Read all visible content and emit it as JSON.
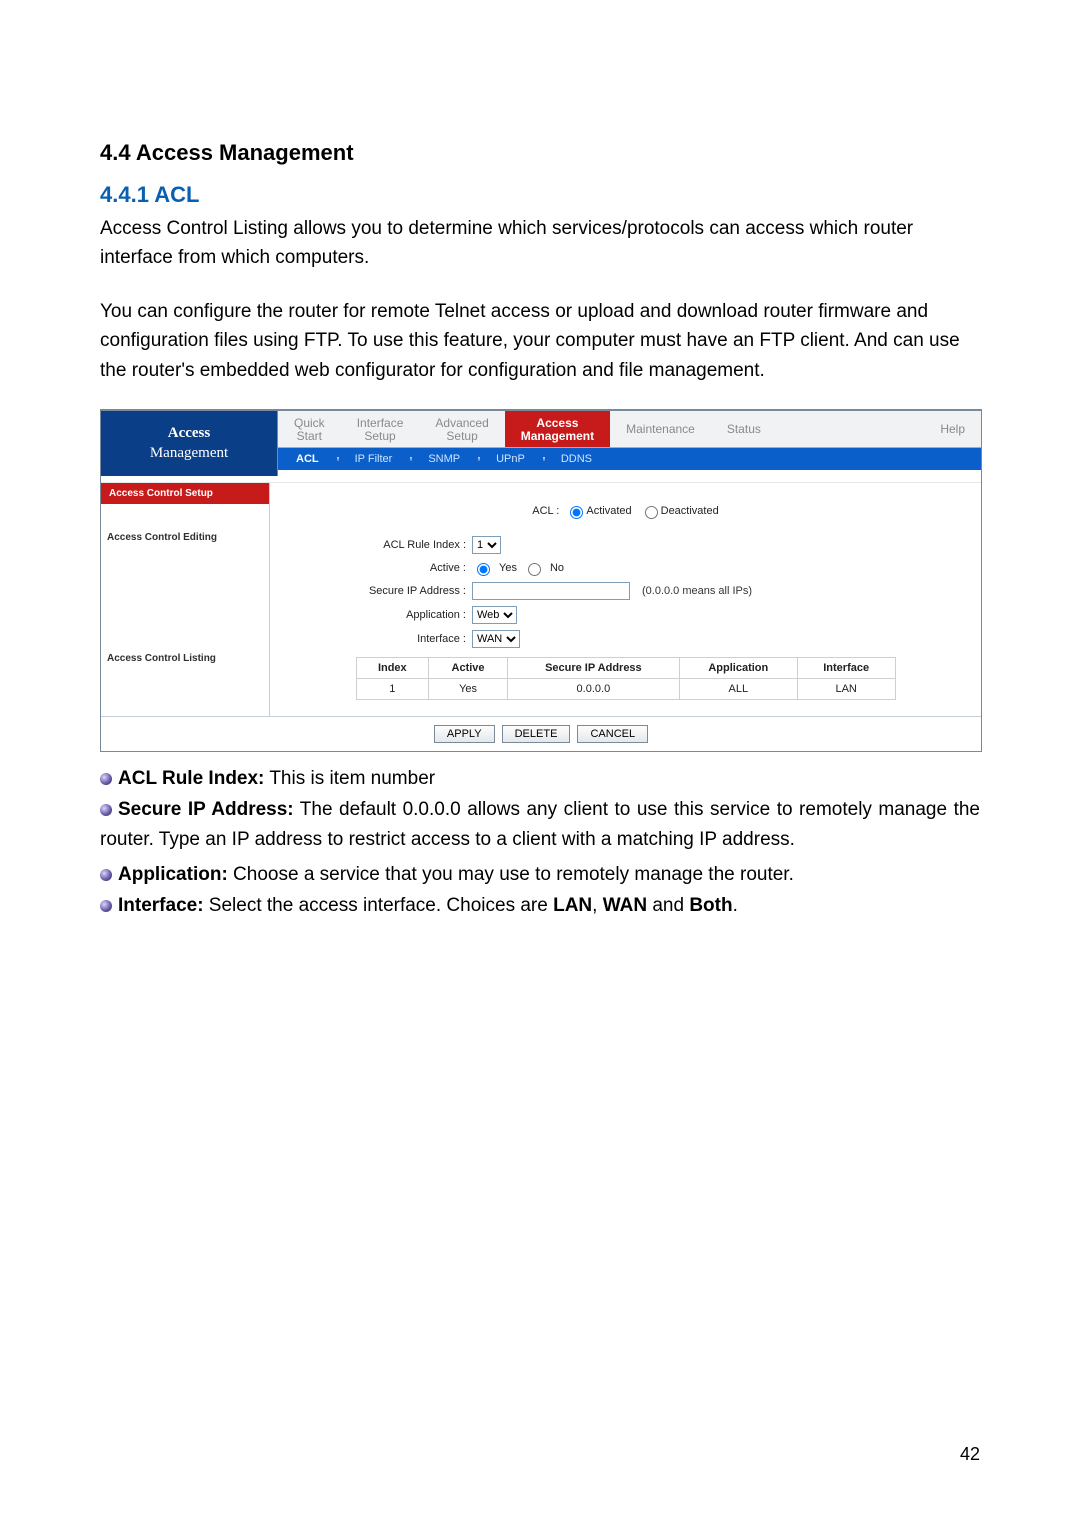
{
  "doc": {
    "section_title": "4.4 Access Management",
    "subsection_title": "4.4.1 ACL",
    "para1": "Access Control Listing allows you to determine which services/protocols can access which router interface from which computers.",
    "para2": "You can configure the router for remote Telnet access or upload and download router firmware and configuration files using FTP. To use this feature, your computer must have an FTP client. And can use the router's embedded web configurator for configuration and file management.",
    "bullets": {
      "acl_index_label": "ACL Rule Index:",
      "acl_index_text": " This is item number",
      "secure_ip_label": "Secure IP Address:",
      "secure_ip_text": " The default 0.0.0.0 allows any client to use this service to remotely manage the router. Type an IP address to restrict access to a client with a matching IP address.",
      "application_label": "Application:",
      "application_text": " Choose a service that you may use to remotely manage the router.",
      "interface_label": "Interface:",
      "interface_text_pre": " Select the access interface. Choices are ",
      "lan": "LAN",
      "wan": "WAN",
      "both": "Both",
      "and": " and ",
      "comma": ", ",
      "period": "."
    },
    "page_number": "42"
  },
  "ui": {
    "title_line1": "Access",
    "title_line2": "Management",
    "tabs": {
      "quick_l1": "Quick",
      "quick_l2": "Start",
      "iface_l1": "Interface",
      "iface_l2": "Setup",
      "adv_l1": "Advanced",
      "adv_l2": "Setup",
      "active_l1": "Access",
      "active_l2": "Management",
      "maint": "Maintenance",
      "status": "Status",
      "help": "Help"
    },
    "subtabs": {
      "acl": "ACL",
      "ipf": "IP Filter",
      "snmp": "SNMP",
      "upnp": "UPnP",
      "ddns": "DDNS"
    },
    "side": {
      "setup": "Access Control Setup",
      "editing": "Access Control Editing",
      "listing": "Access Control Listing"
    },
    "form": {
      "acl_lbl": "ACL :",
      "activated": "Activated",
      "deactivated": "Deactivated",
      "rule_index_lbl": "ACL Rule Index :",
      "rule_index_val": "1",
      "active_lbl": "Active :",
      "yes": "Yes",
      "no": "No",
      "secure_ip_lbl": "Secure IP Address :",
      "secure_ip_val": "",
      "secure_ip_note": "(0.0.0.0 means all IPs)",
      "application_lbl": "Application :",
      "application_val": "Web",
      "interface_lbl": "Interface :",
      "interface_val": "WAN"
    },
    "table": {
      "h_index": "Index",
      "h_active": "Active",
      "h_secure": "Secure IP Address",
      "h_app": "Application",
      "h_iface": "Interface",
      "r_index": "1",
      "r_active": "Yes",
      "r_secure": "0.0.0.0",
      "r_app": "ALL",
      "r_iface": "LAN"
    },
    "buttons": {
      "apply": "APPLY",
      "delete": "DELETE",
      "cancel": "CANCEL"
    }
  }
}
